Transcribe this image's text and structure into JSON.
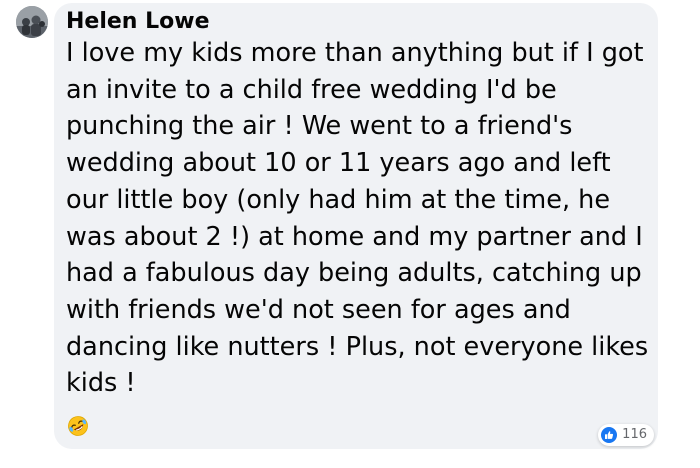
{
  "comment": {
    "author": "Helen Lowe",
    "text": "I love my kids more than anything but if I got an invite to a child free wedding I'd be punching the air ! We went to a friend's wedding about 10 or 11 years ago and left our little boy (only had him at the time, he was about 2 !) at home and my partner and I had a fabulous day being adults, catching up with friends we'd not seen for ages and dancing like nutters ! Plus, not everyone likes kids !",
    "emoji": "rolling-on-floor-laughing-emoji",
    "reactions": {
      "icon": "like-icon",
      "count": "116"
    }
  },
  "colors": {
    "bubble_background": "#f0f2f5",
    "text": "#050505",
    "like_blue": "#1877f2",
    "count_gray": "#65676b"
  }
}
